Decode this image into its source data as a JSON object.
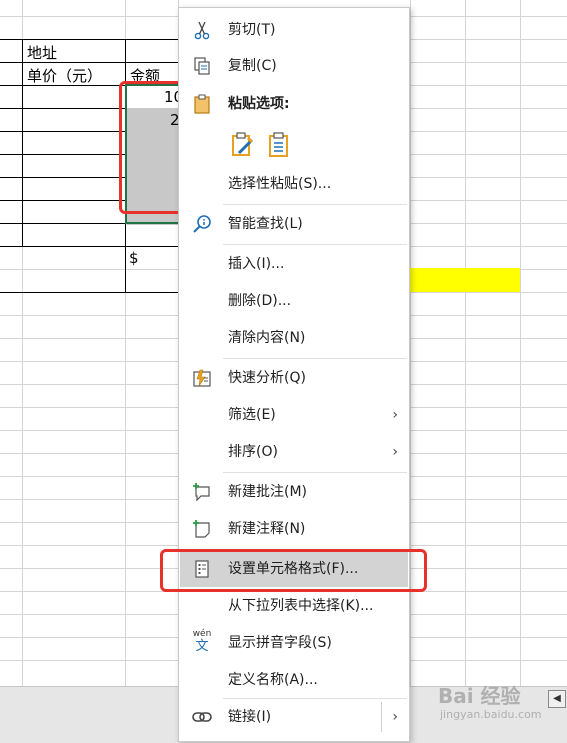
{
  "sheet": {
    "header_address": "地址",
    "header_unit_price": "单价（元）",
    "header_amount": "金额",
    "amount_values": [
      "10",
      "2"
    ],
    "currency_symbol": "$"
  },
  "context_menu": {
    "items": [
      {
        "label": "剪切(T)",
        "icon": "scissors-icon"
      },
      {
        "label": "复制(C)",
        "icon": "copy-icon"
      },
      {
        "label": "粘贴选项:",
        "icon": "clipboard-icon"
      },
      {
        "label": "选择性粘贴(S)...",
        "icon": ""
      },
      {
        "label": "智能查找(L)",
        "icon": "smart-lookup-icon"
      },
      {
        "label": "插入(I)...",
        "icon": ""
      },
      {
        "label": "删除(D)...",
        "icon": ""
      },
      {
        "label": "清除内容(N)",
        "icon": ""
      },
      {
        "label": "快速分析(Q)",
        "icon": "quick-analysis-icon"
      },
      {
        "label": "筛选(E)",
        "icon": "",
        "submenu": true
      },
      {
        "label": "排序(O)",
        "icon": "",
        "submenu": true
      },
      {
        "label": "新建批注(M)",
        "icon": "new-comment-icon"
      },
      {
        "label": "新建注释(N)",
        "icon": "new-note-icon"
      },
      {
        "label": "设置单元格格式(F)...",
        "icon": "format-cells-icon",
        "highlighted": true
      },
      {
        "label": "从下拉列表中选择(K)...",
        "icon": ""
      },
      {
        "label": "显示拼音字段(S)",
        "icon": "phonetic-icon"
      },
      {
        "label": "定义名称(A)...",
        "icon": ""
      },
      {
        "label": "链接(I)",
        "icon": "link-icon",
        "submenu": true
      }
    ],
    "paste_option_icons": [
      "paste-formatting-icon",
      "paste-values-icon"
    ],
    "phonetic_icon_text_top": "wén",
    "phonetic_icon_text_bottom": "文",
    "submenu_arrow": "›"
  },
  "watermark": {
    "text": "Bai 经验",
    "sub": "jingyan.baidu.com"
  },
  "colors": {
    "annotation_red": "#e8312a",
    "highlight_yellow": "#ffff00",
    "selection_gray": "#c8c8c8",
    "menu_hover": "#d3d3d3",
    "icon_blue": "#1f6fb2",
    "icon_orange": "#e8a020"
  }
}
